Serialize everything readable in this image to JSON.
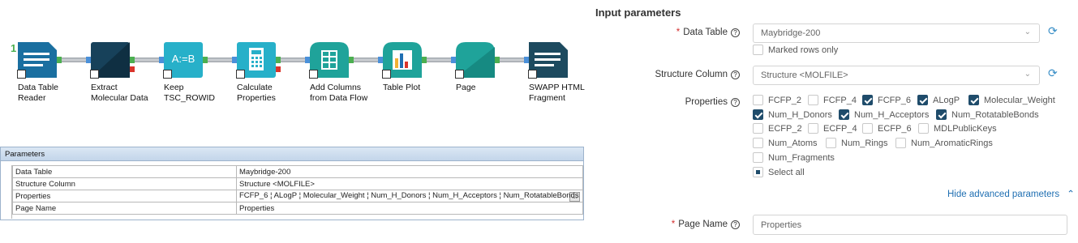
{
  "pipeline": {
    "stage_number": "1",
    "nodes": [
      {
        "label_line1": "Data Table",
        "label_line2": "Reader",
        "icon": "document-lines-icon"
      },
      {
        "label_line1": "Extract",
        "label_line2": "Molecular Data",
        "icon": "molecule-extract-icon"
      },
      {
        "label_line1": "Keep",
        "label_line2": "TSC_ROWID",
        "icon": "assign-icon",
        "icon_text": "A:=B"
      },
      {
        "label_line1": "Calculate",
        "label_line2": "Properties",
        "icon": "calculator-icon"
      },
      {
        "label_line1": "Add Columns",
        "label_line2": "from Data Flow",
        "icon": "add-columns-icon"
      },
      {
        "label_line1": "Table Plot",
        "label_line2": "",
        "icon": "bar-chart-icon"
      },
      {
        "label_line1": "Page",
        "label_line2": "",
        "icon": "page-icon"
      },
      {
        "label_line1": "SWAPP HTML",
        "label_line2": "Fragment",
        "icon": "html-fragment-icon"
      }
    ]
  },
  "parameters_panel": {
    "title": "Parameters",
    "rows": [
      {
        "key": "Data Table",
        "value": "Maybridge-200"
      },
      {
        "key": "Structure Column",
        "value": "Structure <MOLFILE>"
      },
      {
        "key": "Properties",
        "value": "FCFP_6 ¦ ALogP ¦ Molecular_Weight ¦ Num_H_Donors ¦ Num_H_Acceptors ¦ Num_RotatableBonds",
        "ellipsis": "..."
      },
      {
        "key": "Page Name",
        "value": "Properties"
      }
    ]
  },
  "form": {
    "title": "Input parameters",
    "data_table": {
      "label": "Data Table",
      "value": "Maybridge-200",
      "marked_rows": "Marked rows only"
    },
    "structure_column": {
      "label": "Structure Column",
      "value": "Structure <MOLFILE>"
    },
    "properties": {
      "label": "Properties",
      "options": [
        {
          "name": "FCFP_2",
          "checked": false
        },
        {
          "name": "FCFP_4",
          "checked": false
        },
        {
          "name": "FCFP_6",
          "checked": true
        },
        {
          "name": "ALogP",
          "checked": true
        },
        {
          "name": "Molecular_Weight",
          "checked": true
        },
        {
          "name": "Num_H_Donors",
          "checked": true
        },
        {
          "name": "Num_H_Acceptors",
          "checked": true
        },
        {
          "name": "Num_RotatableBonds",
          "checked": true
        },
        {
          "name": "ECFP_2",
          "checked": false
        },
        {
          "name": "ECFP_4",
          "checked": false
        },
        {
          "name": "ECFP_6",
          "checked": false
        },
        {
          "name": "MDLPublicKeys",
          "checked": false
        },
        {
          "name": "Num_Atoms",
          "checked": false
        },
        {
          "name": "Num_Rings",
          "checked": false
        },
        {
          "name": "Num_AromaticRings",
          "checked": false
        },
        {
          "name": "Num_Fragments",
          "checked": false
        }
      ],
      "select_all": "Select all"
    },
    "advanced_link": "Hide advanced parameters",
    "page_name": {
      "label": "Page Name",
      "value": "Properties"
    }
  },
  "colors": {
    "node_blue": "#1a6fa0",
    "node_dark": "#1d4a5f",
    "node_cyan": "#27b0c9",
    "node_teal": "#1fa39a",
    "checkbox_checked": "#1f4c6b",
    "link": "#1f6fb2"
  }
}
